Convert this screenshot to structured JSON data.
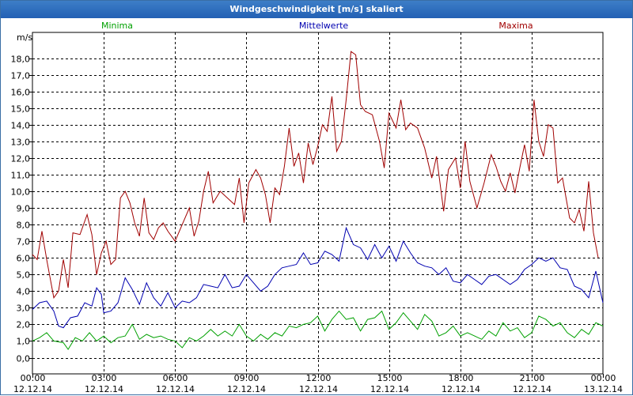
{
  "window": {
    "title": "Windgeschwindigkeit [m/s] skaliert"
  },
  "colors": {
    "minima": "#00a000",
    "mittelwerte": "#0000b0",
    "maxima": "#a00000",
    "frame": "#3a6ea5"
  },
  "chart_data": {
    "type": "line",
    "ylabel": "m/s",
    "ylim": [
      0,
      19
    ],
    "yticks": [
      "0,0",
      "1,0",
      "2,0",
      "3,0",
      "4,0",
      "5,0",
      "6,0",
      "7,0",
      "8,0",
      "9,0",
      "10,0",
      "11,0",
      "12,0",
      "13,0",
      "14,0",
      "15,0",
      "16,0",
      "17,0",
      "18,0"
    ],
    "xlim": [
      0,
      24
    ],
    "xticks": [
      {
        "time": "00:00",
        "date": "12.12.14"
      },
      {
        "time": "03:00",
        "date": "12.12.14"
      },
      {
        "time": "06:00",
        "date": "12.12.14"
      },
      {
        "time": "09:00",
        "date": "12.12.14"
      },
      {
        "time": "12:00",
        "date": "12.12.14"
      },
      {
        "time": "15:00",
        "date": "12.12.14"
      },
      {
        "time": "18:00",
        "date": "12.12.14"
      },
      {
        "time": "21:00",
        "date": "12.12.14"
      },
      {
        "time": "00:00",
        "date": "13.12.14"
      }
    ],
    "grid": true,
    "series": [
      {
        "name": "Minima",
        "points": [
          [
            0,
            1.0
          ],
          [
            0.3,
            1.2
          ],
          [
            0.6,
            1.5
          ],
          [
            0.9,
            1.0
          ],
          [
            1.3,
            0.9
          ],
          [
            1.5,
            0.5
          ],
          [
            1.8,
            1.2
          ],
          [
            2.1,
            1.0
          ],
          [
            2.4,
            1.5
          ],
          [
            2.7,
            1.0
          ],
          [
            3.0,
            1.3
          ],
          [
            3.3,
            0.9
          ],
          [
            3.6,
            1.2
          ],
          [
            3.9,
            1.3
          ],
          [
            4.2,
            2.0
          ],
          [
            4.5,
            1.1
          ],
          [
            4.8,
            1.4
          ],
          [
            5.1,
            1.2
          ],
          [
            5.4,
            1.3
          ],
          [
            5.7,
            1.1
          ],
          [
            6.0,
            1.0
          ],
          [
            6.3,
            0.6
          ],
          [
            6.6,
            1.2
          ],
          [
            6.9,
            1.0
          ],
          [
            7.2,
            1.3
          ],
          [
            7.5,
            1.7
          ],
          [
            7.8,
            1.3
          ],
          [
            8.1,
            1.6
          ],
          [
            8.4,
            1.3
          ],
          [
            8.7,
            2.0
          ],
          [
            9.0,
            1.3
          ],
          [
            9.3,
            1.0
          ],
          [
            9.6,
            1.4
          ],
          [
            9.9,
            1.1
          ],
          [
            10.2,
            1.5
          ],
          [
            10.5,
            1.3
          ],
          [
            10.8,
            1.9
          ],
          [
            11.1,
            1.8
          ],
          [
            11.4,
            2.0
          ],
          [
            11.7,
            2.1
          ],
          [
            12.0,
            2.5
          ],
          [
            12.3,
            1.6
          ],
          [
            12.6,
            2.3
          ],
          [
            12.9,
            2.8
          ],
          [
            13.2,
            2.3
          ],
          [
            13.5,
            2.4
          ],
          [
            13.8,
            1.6
          ],
          [
            14.1,
            2.3
          ],
          [
            14.4,
            2.4
          ],
          [
            14.7,
            2.8
          ],
          [
            15.0,
            1.7
          ],
          [
            15.3,
            2.1
          ],
          [
            15.6,
            2.7
          ],
          [
            15.9,
            2.2
          ],
          [
            16.2,
            1.7
          ],
          [
            16.5,
            2.6
          ],
          [
            16.8,
            2.2
          ],
          [
            17.1,
            1.3
          ],
          [
            17.4,
            1.5
          ],
          [
            17.7,
            1.9
          ],
          [
            18.0,
            1.3
          ],
          [
            18.3,
            1.5
          ],
          [
            18.6,
            1.3
          ],
          [
            18.9,
            1.1
          ],
          [
            19.2,
            1.6
          ],
          [
            19.5,
            1.3
          ],
          [
            19.8,
            2.1
          ],
          [
            20.1,
            1.6
          ],
          [
            20.4,
            1.8
          ],
          [
            20.7,
            1.2
          ],
          [
            21.0,
            1.5
          ],
          [
            21.3,
            2.5
          ],
          [
            21.6,
            2.3
          ],
          [
            21.9,
            1.9
          ],
          [
            22.2,
            2.1
          ],
          [
            22.5,
            1.5
          ],
          [
            22.8,
            1.2
          ],
          [
            23.1,
            1.7
          ],
          [
            23.4,
            1.4
          ],
          [
            23.7,
            2.1
          ],
          [
            24.0,
            1.9
          ]
        ]
      },
      {
        "name": "Mittelwerte",
        "points": [
          [
            0,
            2.9
          ],
          [
            0.3,
            3.3
          ],
          [
            0.6,
            3.4
          ],
          [
            0.9,
            2.8
          ],
          [
            1.1,
            1.9
          ],
          [
            1.3,
            1.8
          ],
          [
            1.6,
            2.4
          ],
          [
            1.9,
            2.5
          ],
          [
            2.2,
            3.3
          ],
          [
            2.5,
            3.1
          ],
          [
            2.7,
            4.2
          ],
          [
            2.9,
            3.8
          ],
          [
            3.0,
            2.7
          ],
          [
            3.3,
            2.8
          ],
          [
            3.6,
            3.3
          ],
          [
            3.9,
            4.8
          ],
          [
            4.2,
            4.1
          ],
          [
            4.5,
            3.2
          ],
          [
            4.8,
            4.5
          ],
          [
            5.1,
            3.6
          ],
          [
            5.4,
            3.1
          ],
          [
            5.7,
            3.9
          ],
          [
            6.0,
            3.0
          ],
          [
            6.3,
            3.4
          ],
          [
            6.6,
            3.3
          ],
          [
            6.9,
            3.6
          ],
          [
            7.2,
            4.4
          ],
          [
            7.5,
            4.3
          ],
          [
            7.8,
            4.2
          ],
          [
            8.1,
            5.0
          ],
          [
            8.4,
            4.2
          ],
          [
            8.7,
            4.3
          ],
          [
            9.0,
            5.0
          ],
          [
            9.3,
            4.5
          ],
          [
            9.6,
            4.0
          ],
          [
            9.9,
            4.3
          ],
          [
            10.2,
            5.0
          ],
          [
            10.5,
            5.4
          ],
          [
            10.8,
            5.5
          ],
          [
            11.1,
            5.6
          ],
          [
            11.4,
            6.3
          ],
          [
            11.7,
            5.6
          ],
          [
            12.0,
            5.7
          ],
          [
            12.3,
            6.4
          ],
          [
            12.6,
            6.2
          ],
          [
            12.9,
            5.8
          ],
          [
            13.2,
            7.8
          ],
          [
            13.5,
            6.8
          ],
          [
            13.8,
            6.6
          ],
          [
            14.1,
            5.9
          ],
          [
            14.4,
            6.8
          ],
          [
            14.7,
            6.0
          ],
          [
            15.0,
            6.7
          ],
          [
            15.3,
            5.8
          ],
          [
            15.6,
            7.0
          ],
          [
            15.9,
            6.3
          ],
          [
            16.2,
            5.7
          ],
          [
            16.5,
            5.5
          ],
          [
            16.8,
            5.4
          ],
          [
            17.1,
            5.0
          ],
          [
            17.4,
            5.4
          ],
          [
            17.7,
            4.6
          ],
          [
            18.0,
            4.5
          ],
          [
            18.3,
            5.0
          ],
          [
            18.6,
            4.7
          ],
          [
            18.9,
            4.4
          ],
          [
            19.2,
            4.9
          ],
          [
            19.5,
            5.0
          ],
          [
            19.8,
            4.7
          ],
          [
            20.1,
            4.4
          ],
          [
            20.4,
            4.7
          ],
          [
            20.7,
            5.3
          ],
          [
            21.0,
            5.6
          ],
          [
            21.3,
            6.0
          ],
          [
            21.6,
            5.8
          ],
          [
            21.9,
            6.0
          ],
          [
            22.2,
            5.4
          ],
          [
            22.5,
            5.3
          ],
          [
            22.8,
            4.3
          ],
          [
            23.1,
            4.1
          ],
          [
            23.4,
            3.6
          ],
          [
            23.7,
            5.2
          ],
          [
            24.0,
            3.3
          ]
        ]
      },
      {
        "name": "Maxima",
        "points": [
          [
            0,
            6.2
          ],
          [
            0.2,
            5.9
          ],
          [
            0.4,
            7.6
          ],
          [
            0.6,
            5.9
          ],
          [
            0.9,
            3.6
          ],
          [
            1.1,
            4.0
          ],
          [
            1.3,
            5.9
          ],
          [
            1.5,
            4.2
          ],
          [
            1.7,
            7.5
          ],
          [
            2.0,
            7.4
          ],
          [
            2.3,
            8.6
          ],
          [
            2.5,
            7.4
          ],
          [
            2.7,
            5.0
          ],
          [
            2.9,
            6.3
          ],
          [
            3.1,
            7.0
          ],
          [
            3.3,
            5.6
          ],
          [
            3.5,
            5.9
          ],
          [
            3.7,
            9.6
          ],
          [
            3.9,
            10.0
          ],
          [
            4.1,
            9.3
          ],
          [
            4.3,
            8.1
          ],
          [
            4.5,
            7.3
          ],
          [
            4.7,
            9.6
          ],
          [
            4.9,
            7.5
          ],
          [
            5.1,
            7.1
          ],
          [
            5.3,
            7.8
          ],
          [
            5.5,
            8.1
          ],
          [
            5.7,
            7.6
          ],
          [
            6.0,
            7.0
          ],
          [
            6.3,
            8.0
          ],
          [
            6.6,
            9.0
          ],
          [
            6.8,
            7.3
          ],
          [
            7.0,
            8.2
          ],
          [
            7.2,
            10.0
          ],
          [
            7.4,
            11.2
          ],
          [
            7.6,
            9.3
          ],
          [
            7.9,
            10.0
          ],
          [
            8.2,
            9.6
          ],
          [
            8.5,
            9.2
          ],
          [
            8.7,
            10.8
          ],
          [
            8.9,
            8.1
          ],
          [
            9.1,
            10.5
          ],
          [
            9.4,
            11.3
          ],
          [
            9.6,
            10.8
          ],
          [
            9.8,
            9.8
          ],
          [
            10.0,
            8.1
          ],
          [
            10.2,
            10.2
          ],
          [
            10.4,
            9.8
          ],
          [
            10.6,
            11.5
          ],
          [
            10.8,
            13.8
          ],
          [
            11.0,
            11.5
          ],
          [
            11.2,
            12.3
          ],
          [
            11.4,
            10.5
          ],
          [
            11.6,
            12.9
          ],
          [
            11.8,
            11.6
          ],
          [
            12.0,
            12.7
          ],
          [
            12.2,
            14.0
          ],
          [
            12.4,
            13.6
          ],
          [
            12.6,
            15.7
          ],
          [
            12.8,
            12.4
          ],
          [
            13.0,
            13.0
          ],
          [
            13.2,
            15.5
          ],
          [
            13.4,
            18.4
          ],
          [
            13.6,
            18.2
          ],
          [
            13.8,
            15.2
          ],
          [
            14.0,
            14.8
          ],
          [
            14.3,
            14.6
          ],
          [
            14.6,
            13.0
          ],
          [
            14.8,
            11.4
          ],
          [
            15.0,
            14.7
          ],
          [
            15.3,
            13.8
          ],
          [
            15.5,
            15.5
          ],
          [
            15.7,
            13.7
          ],
          [
            15.9,
            14.1
          ],
          [
            16.2,
            13.8
          ],
          [
            16.5,
            12.6
          ],
          [
            16.8,
            10.8
          ],
          [
            17.0,
            12.1
          ],
          [
            17.3,
            8.8
          ],
          [
            17.5,
            11.3
          ],
          [
            17.8,
            12.0
          ],
          [
            18.0,
            10.2
          ],
          [
            18.2,
            13.0
          ],
          [
            18.4,
            10.6
          ],
          [
            18.7,
            9.0
          ],
          [
            19.0,
            10.5
          ],
          [
            19.3,
            12.2
          ],
          [
            19.5,
            11.5
          ],
          [
            19.7,
            10.6
          ],
          [
            19.9,
            10.0
          ],
          [
            20.1,
            11.1
          ],
          [
            20.3,
            9.9
          ],
          [
            20.5,
            11.4
          ],
          [
            20.7,
            12.8
          ],
          [
            20.9,
            11.2
          ],
          [
            21.1,
            15.5
          ],
          [
            21.3,
            13.0
          ],
          [
            21.5,
            12.1
          ],
          [
            21.7,
            14.0
          ],
          [
            21.9,
            13.8
          ],
          [
            22.1,
            10.5
          ],
          [
            22.3,
            10.8
          ],
          [
            22.6,
            8.4
          ],
          [
            22.8,
            8.1
          ],
          [
            23.0,
            8.9
          ],
          [
            23.2,
            7.6
          ],
          [
            23.4,
            10.6
          ],
          [
            23.6,
            7.5
          ],
          [
            23.8,
            6.0
          ]
        ]
      }
    ]
  }
}
